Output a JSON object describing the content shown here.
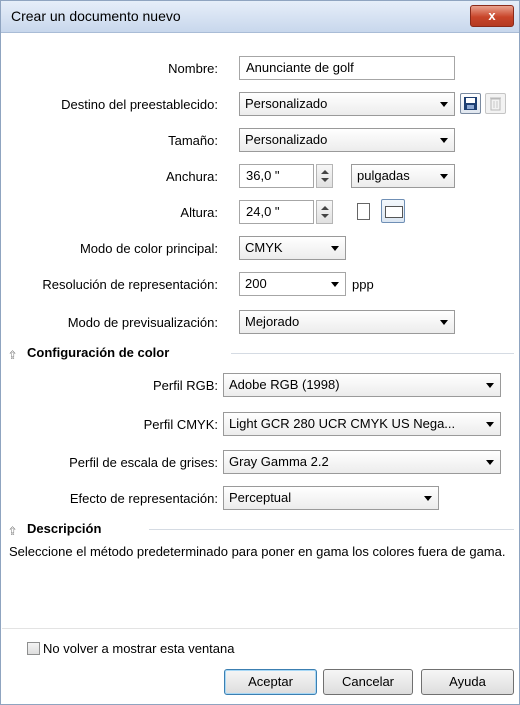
{
  "window": {
    "title": "Crear un documento nuevo",
    "close_label": "x"
  },
  "form": {
    "nombre": {
      "label": "Nombre:",
      "value": "Anunciante de golf"
    },
    "destino": {
      "label": "Destino del preestablecido:",
      "value": "Personalizado"
    },
    "tamano": {
      "label": "Tamaño:",
      "value": "Personalizado"
    },
    "anchura": {
      "label": "Anchura:",
      "value": "36,0 \"",
      "units": "pulgadas"
    },
    "altura": {
      "label": "Altura:",
      "value": "24,0 \""
    },
    "modo_color": {
      "label": "Modo de color principal:",
      "value": "CMYK"
    },
    "resolucion": {
      "label": "Resolución de representación:",
      "value": "200",
      "unit": "ppp"
    },
    "previsualizacion": {
      "label": "Modo de previsualización:",
      "value": "Mejorado"
    }
  },
  "color_section": {
    "title": "Configuración de color",
    "perfil_rgb": {
      "label": "Perfil RGB:",
      "value": "Adobe RGB (1998)"
    },
    "perfil_cmyk": {
      "label": "Perfil CMYK:",
      "value": "Light GCR 280 UCR CMYK US Nega..."
    },
    "perfil_grises": {
      "label": "Perfil de escala de grises:",
      "value": "Gray Gamma 2.2"
    },
    "efecto": {
      "label": "Efecto de representación:",
      "value": "Perceptual"
    }
  },
  "description_section": {
    "title": "Descripción",
    "text": "Seleccione el método predeterminado para poner en gama los colores fuera de gama."
  },
  "footer": {
    "checkbox_label": "No volver a mostrar esta ventana",
    "checkbox_checked": false,
    "ok": "Aceptar",
    "cancel": "Cancelar",
    "help": "Ayuda"
  }
}
